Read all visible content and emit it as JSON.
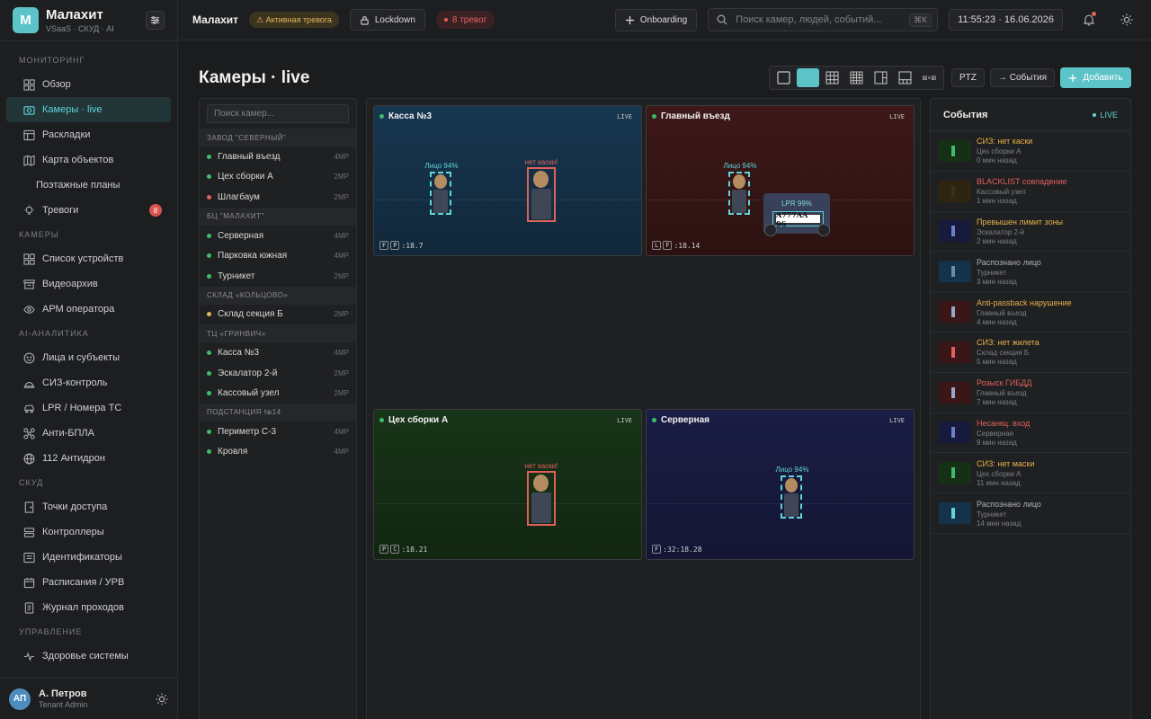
{
  "brand": {
    "initial": "M",
    "name": "Малахит",
    "subtitle": "VSaaS · СКУД · AI"
  },
  "sidebar": {
    "sections": [
      {
        "title": "МОНИТОРИНГ",
        "items": [
          {
            "label": "Обзор",
            "icon": "grid-icon"
          },
          {
            "label": "Камеры · live",
            "icon": "camera-icon",
            "active": true
          },
          {
            "label": "Раскладки",
            "icon": "layout-icon"
          },
          {
            "label": "Карта объектов",
            "icon": "map-icon"
          },
          {
            "label": "Поэтажные планы",
            "icon": "",
            "sub": true
          },
          {
            "label": "Тревоги",
            "icon": "bulb-icon",
            "badge": "8"
          }
        ]
      },
      {
        "title": "КАМЕРЫ",
        "items": [
          {
            "label": "Список устройств",
            "icon": "devices-icon"
          },
          {
            "label": "Видеоархив",
            "icon": "archive-icon"
          },
          {
            "label": "АРМ оператора",
            "icon": "eye-icon"
          }
        ]
      },
      {
        "title": "AI-АНАЛИТИКА",
        "items": [
          {
            "label": "Лица и субъекты",
            "icon": "face-icon"
          },
          {
            "label": "СИЗ-контроль",
            "icon": "helmet-icon"
          },
          {
            "label": "LPR / Номера ТС",
            "icon": "car-icon"
          },
          {
            "label": "Анти-БПЛА",
            "icon": "drone-icon"
          },
          {
            "label": "112 Антидрон",
            "icon": "globe-icon"
          }
        ]
      },
      {
        "title": "СКУД",
        "items": [
          {
            "label": "Точки доступа",
            "icon": "door-icon"
          },
          {
            "label": "Контроллеры",
            "icon": "controller-icon"
          },
          {
            "label": "Идентификаторы",
            "icon": "card-icon"
          },
          {
            "label": "Расписания / УРВ",
            "icon": "calendar-icon"
          },
          {
            "label": "Журнал проходов",
            "icon": "journal-icon"
          }
        ]
      },
      {
        "title": "УПРАВЛЕНИЕ",
        "items": [
          {
            "label": "Здоровье системы",
            "icon": "pulse-icon"
          }
        ]
      }
    ]
  },
  "user": {
    "initials": "АП",
    "name": "А. Петров",
    "role": "Tenant Admin"
  },
  "topbar": {
    "title": "Малахит",
    "alarm_pill": "⚠ Активная тревога",
    "lockdown": "Lockdown",
    "alarms_count": "8 тревог",
    "onboarding": "Onboarding",
    "search_placeholder": "Поиск камер, людей, событий...",
    "search_kbd": "⌘K",
    "clock": "11:55:23 · 16.06.2026"
  },
  "main": {
    "title": "Камеры · live",
    "view_modes": [
      "1x1",
      "2x2",
      "3x3",
      "4x4",
      "1+5",
      "1+7",
      "custom"
    ],
    "custom_view_label": "⊠×⊠",
    "ptz_label": "PTZ",
    "events_label": "→ События",
    "add_label": "Добавить"
  },
  "camera_list": {
    "search_placeholder": "Поиск камер...",
    "groups": [
      {
        "name": "ЗАВОД \"СЕВЕРНЫЙ\"",
        "cameras": [
          {
            "name": "Главный въезд",
            "res": "4MP",
            "status": "#3dbd6a"
          },
          {
            "name": "Цех сборки А",
            "res": "2MP",
            "status": "#3dbd6a"
          },
          {
            "name": "Шлагбаум",
            "res": "2MP",
            "status": "#e0605b"
          }
        ]
      },
      {
        "name": "БЦ \"МАЛАХИТ\"",
        "cameras": [
          {
            "name": "Серверная",
            "res": "4MP",
            "status": "#3dbd6a"
          },
          {
            "name": "Парковка южная",
            "res": "4MP",
            "status": "#3dbd6a"
          },
          {
            "name": "Турникет",
            "res": "2MP",
            "status": "#3dbd6a"
          }
        ]
      },
      {
        "name": "СКЛАД «КОЛЬЦОВО»",
        "cameras": [
          {
            "name": "Склад секция Б",
            "res": "2MP",
            "status": "#e0b75a"
          }
        ]
      },
      {
        "name": "ТЦ «ГРИНВИЧ»",
        "cameras": [
          {
            "name": "Касса №3",
            "res": "4MP",
            "status": "#3dbd6a"
          },
          {
            "name": "Эскалатор 2-й",
            "res": "2MP",
            "status": "#3dbd6a"
          },
          {
            "name": "Кассовый узел",
            "res": "2MP",
            "status": "#3dbd6a"
          }
        ]
      },
      {
        "name": "ПОДСТАНЦИЯ №14",
        "cameras": [
          {
            "name": "Периметр С-3",
            "res": "4MP",
            "status": "#3dbd6a"
          },
          {
            "name": "Кровля",
            "res": "4MP",
            "status": "#3dbd6a"
          }
        ]
      }
    ]
  },
  "tiles": [
    {
      "name": "Касса №3",
      "live": "LIVE",
      "tags": [
        "F",
        "P"
      ],
      "time": ":18.7",
      "bg": "#14324a"
    },
    {
      "name": "Главный въезд",
      "live": "LIVE",
      "tags": [
        "L",
        "F"
      ],
      "time": ":18.14",
      "bg": "#3a1616"
    },
    {
      "name": "Цех сборки А",
      "live": "LIVE",
      "tags": [
        "P",
        "C"
      ],
      "time": ":18.21",
      "bg": "#163016"
    },
    {
      "name": "Серверная",
      "live": "LIVE",
      "tags": [
        "F"
      ],
      "time": ":32:18.28",
      "bg": "#171a3c"
    }
  ],
  "detections": {
    "face_label": "Лицо 94%",
    "helmet_label": "нет каски!",
    "lpr_label": "LPR 99%",
    "plate_text": "A777AA 96",
    "face_color": "#5fd4d9",
    "alert_color": "#e0605b"
  },
  "events": {
    "title": "События",
    "live_label": "LIVE",
    "items": [
      {
        "title": "СИЗ: нет каски",
        "camera": "Цех сборки А",
        "time": "0 мин назад",
        "color": "#e8b04a",
        "thumb": "#163016",
        "marker": "#3dbd6a"
      },
      {
        "title": "BLACKLIST совпадение",
        "camera": "Кассовый узел",
        "time": "1 мин назад",
        "color": "#e0605b",
        "thumb": "#2e2410",
        "marker": "#3a3020"
      },
      {
        "title": "Превышен лимит зоны",
        "camera": "Эскалатор 2-й",
        "time": "2 мин назад",
        "color": "#e8b04a",
        "thumb": "#171a3c",
        "marker": "#6a80c8"
      },
      {
        "title": "Распознано лицо",
        "camera": "Турникет",
        "time": "3 мин назад",
        "color": "#aeb0b4",
        "thumb": "#14324a",
        "marker": "#6a8ab0"
      },
      {
        "title": "Anti-passback нарушение",
        "camera": "Главный въезд",
        "time": "4 мин назад",
        "color": "#e8b04a",
        "thumb": "#3a1616",
        "marker": "#9aa6c8"
      },
      {
        "title": "СИЗ: нет жилета",
        "camera": "Склад секция Б",
        "time": "5 мин назад",
        "color": "#e8b04a",
        "thumb": "#3a1616",
        "marker": "#e0605b"
      },
      {
        "title": "Розыск ГИБДД",
        "camera": "Главный въезд",
        "time": "7 мин назад",
        "color": "#e0605b",
        "thumb": "#3a1616",
        "marker": "#9aa6c8"
      },
      {
        "title": "Несанкц. вход",
        "camera": "Серверная",
        "time": "9 мин назад",
        "color": "#e0605b",
        "thumb": "#171a3c",
        "marker": "#6a80c8"
      },
      {
        "title": "СИЗ: нет маски",
        "camera": "Цех сборки А",
        "time": "11 мин назад",
        "color": "#e8b04a",
        "thumb": "#163016",
        "marker": "#3dbd6a"
      },
      {
        "title": "Распознано лицо",
        "camera": "Турникет",
        "time": "14 мин назад",
        "color": "#aeb0b4",
        "thumb": "#14324a",
        "marker": "#5fd4d9"
      }
    ]
  }
}
